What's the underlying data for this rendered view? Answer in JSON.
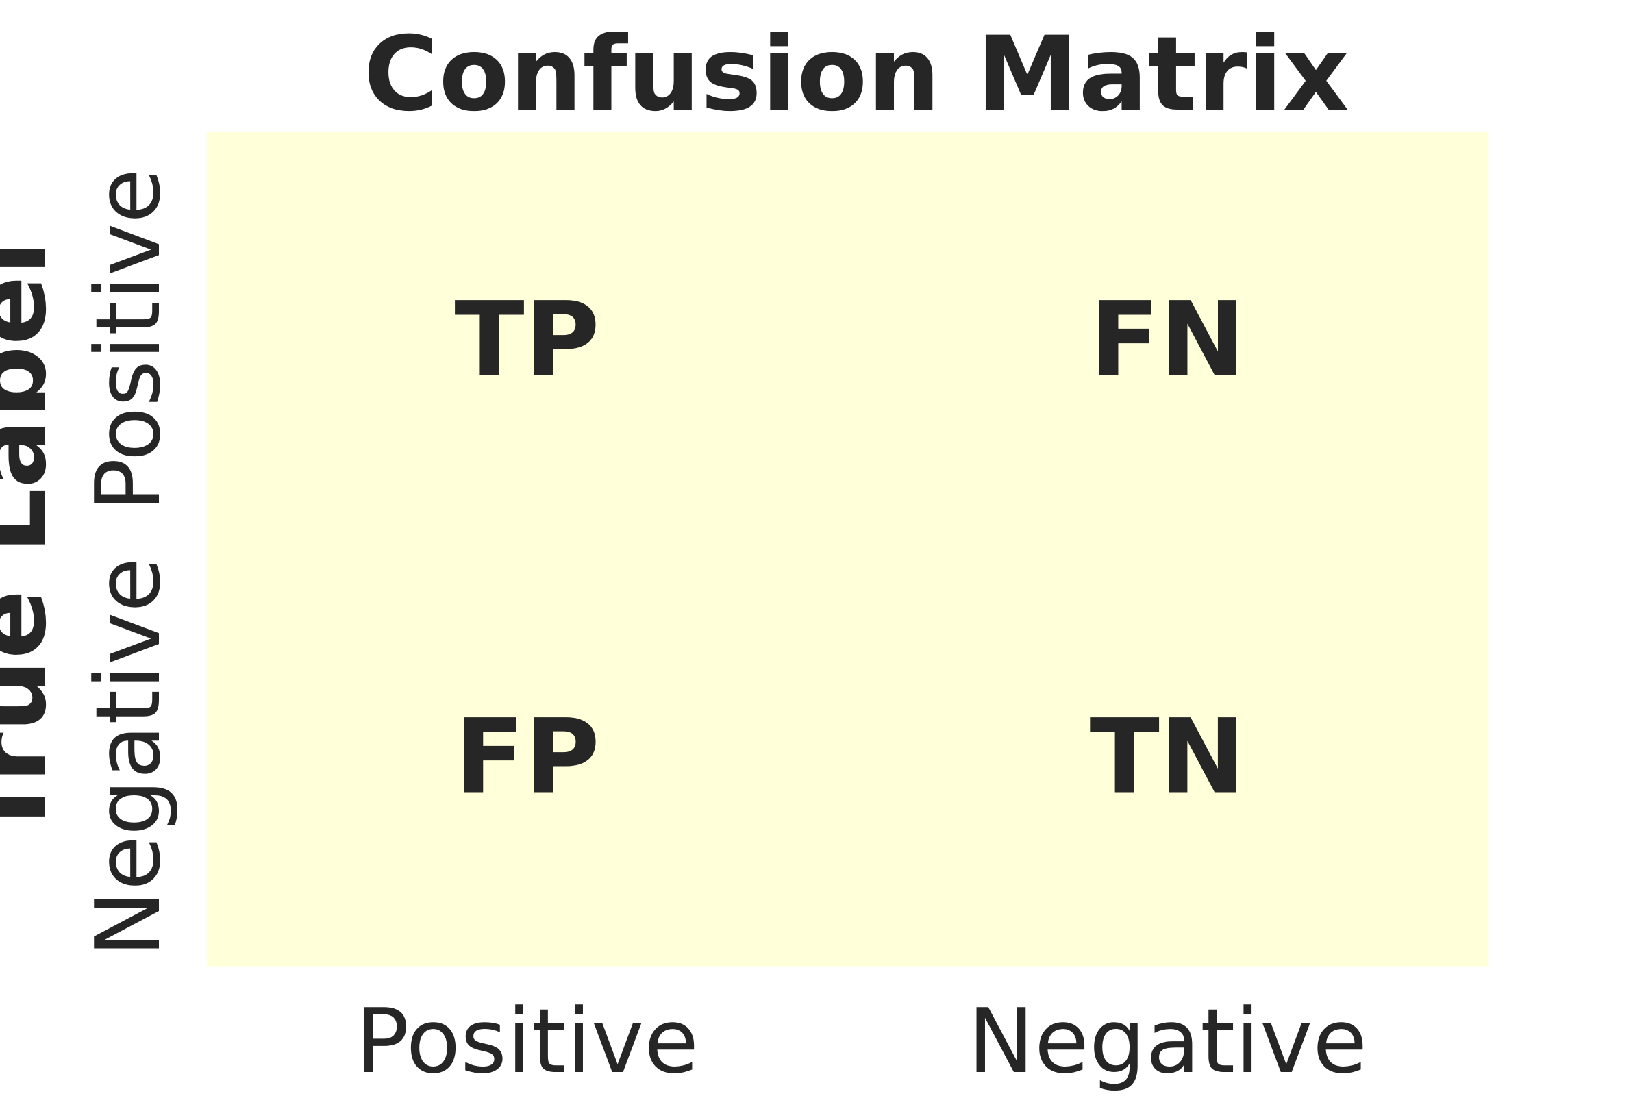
{
  "chart_data": {
    "type": "heatmap",
    "title": "Confusion Matrix",
    "xlabel": "",
    "ylabel": "True Label",
    "x_ticks": [
      "Positive",
      "Negative"
    ],
    "y_ticks": [
      "Positive",
      "Negative"
    ],
    "cells": [
      [
        "TP",
        "FN"
      ],
      [
        "FP",
        "TN"
      ]
    ],
    "cell_color": "#ffffd9",
    "text_color": "#262626"
  }
}
